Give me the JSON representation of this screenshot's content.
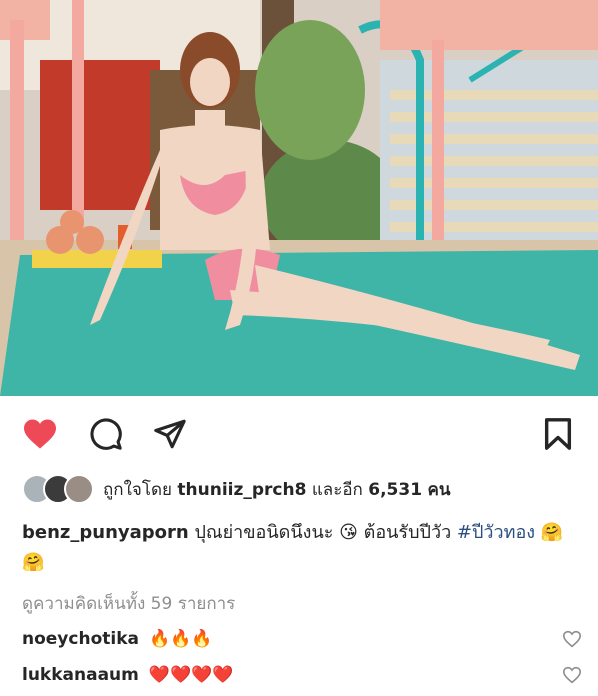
{
  "post": {
    "liked_by_prefix": "ถูกใจโดย",
    "liked_by_user": "thuniiz_prch8",
    "liked_by_and_others": "และอีก",
    "others_count": "6,531",
    "others_unit": "คน",
    "caption_user": "benz_punyaporn",
    "caption_text": "ปุณย่าขอนิดนึงนะ 😘 ต้อนรับปีวัว",
    "caption_hashtag": "#ปีวัวทอง",
    "caption_emoji": "🤗🤗",
    "view_comments": "ดูความคิดเห็นทั้ง 59 รายการ"
  },
  "comments": [
    {
      "user": "noeychotika",
      "text": "🔥🔥🔥"
    },
    {
      "user": "lukkanaaum",
      "text": "❤️❤️❤️❤️"
    }
  ],
  "icons": {
    "like": "heart-icon",
    "comment": "comment-icon",
    "share": "paper-plane-icon",
    "save": "bookmark-icon"
  },
  "colors": {
    "like_active": "#ed4956",
    "text": "#262626",
    "muted": "#8e8e8e",
    "hashtag": "#2a4f80"
  }
}
